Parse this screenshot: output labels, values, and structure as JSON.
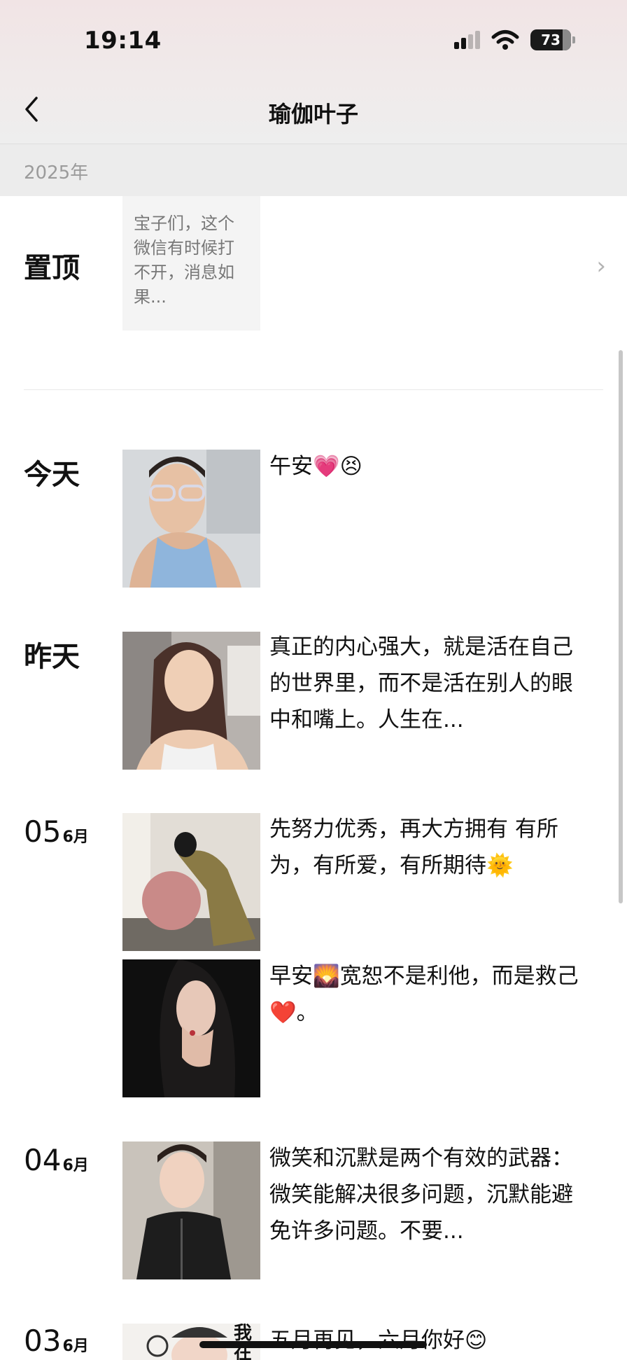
{
  "status_bar": {
    "time": "19:14",
    "battery": "73"
  },
  "nav": {
    "back_icon": "chevron-left-icon",
    "title": "瑜伽叶子"
  },
  "year": "2025年",
  "pinned": {
    "label": "置顶",
    "text": "宝子们，这个微信有时候打不开，消息如果...",
    "chevron": "›"
  },
  "posts": [
    {
      "day": "今天",
      "text": "午安💗😣"
    },
    {
      "day": "昨天",
      "text": "真正的内心强大，就是活在自己的世界里，而不是活在别人的眼中和嘴上。人生在..."
    },
    {
      "day_num": "05",
      "month": "6月",
      "text": "先努力优秀，再大方拥有 有所为，有所爱，有所期待🌞"
    },
    {
      "text": "早安🌄宽恕不是利他，而是救己❤️。"
    },
    {
      "day_num": "04",
      "month": "6月",
      "text": "微笑和沉默是两个有效的武器：微笑能解决很多问题，沉默能避免许多问题。不要..."
    },
    {
      "day_num": "03",
      "month": "6月",
      "text": "五月再见，六月你好😊",
      "thumb_text": "我在"
    }
  ]
}
